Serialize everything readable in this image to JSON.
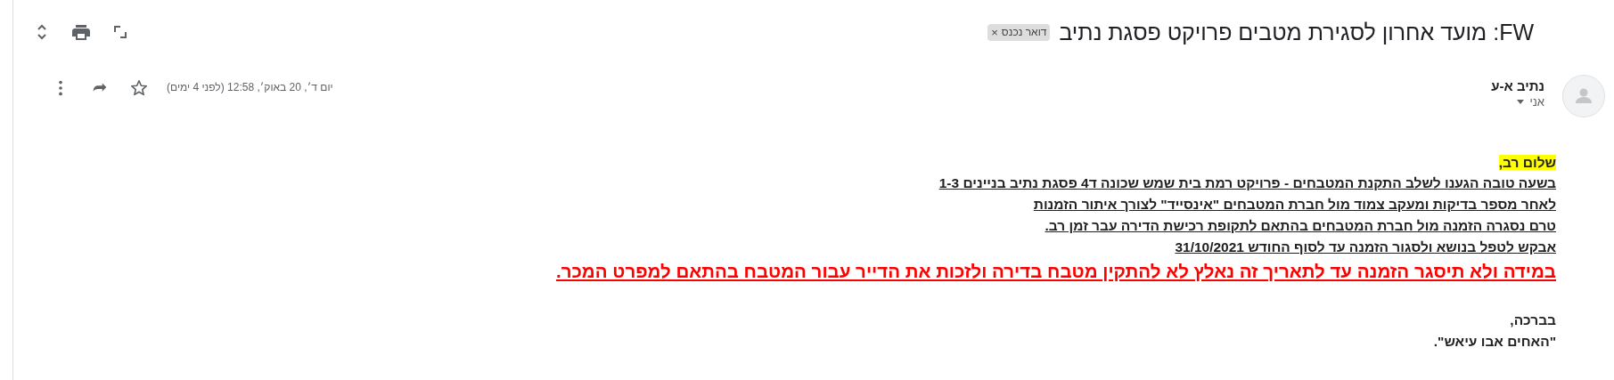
{
  "subject": "FW: מועד אחרון לסגירת מטבים פרויקט פסגת נתיב",
  "label": {
    "text": "דואר נכנס",
    "close": "×"
  },
  "sender": {
    "name": "נתיב א-ע",
    "recipient": "אני"
  },
  "date": "יום ד׳, 20 באוק׳, 12:58 (לפני 4 ימים)",
  "body": [
    {
      "kind": "highlight",
      "text": "שלום רב,"
    },
    {
      "kind": "line",
      "text": "בשעה טובה הגענו לשלב התקנת המטבחים - פרויקט רמת בית שמש שכונה ד4 פסגת נתיב בניינים 1-3"
    },
    {
      "kind": "line",
      "text": "לאחר מספר בדיקות ומעקב צמוד מול חברת המטבחים \"אינסייד\" לצורך איתור הזמנות"
    },
    {
      "kind": "line",
      "text": "טרם נסגרה הזמנה מול חברת המטבחים בהתאם לתקופת רכישת הדירה עבר זמן רב."
    },
    {
      "kind": "line",
      "text": "אבקש לטפל בנושא ולסגור הזמנה עד לסוף החודש 31/10/2021"
    },
    {
      "kind": "alert",
      "text": "במידה ולא תיסגר הזמנה עד לתאריך זה נאלץ לא להתקין מטבח בדירה ולזכות את הדייר עבור המטבח בהתאם למפרט המכר."
    },
    {
      "kind": "gap"
    },
    {
      "kind": "signature",
      "text": "בברכה,"
    },
    {
      "kind": "signature",
      "text": "\"האחים אבו עיאש\"."
    }
  ]
}
